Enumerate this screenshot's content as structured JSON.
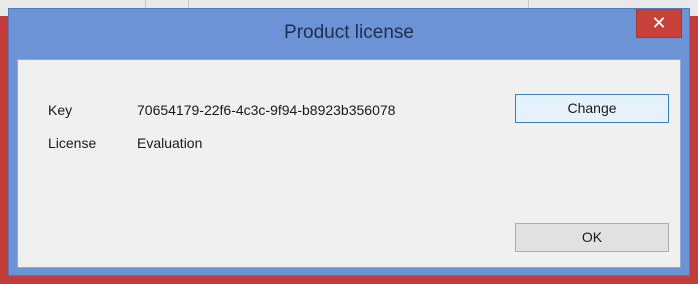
{
  "window": {
    "title": "Product license",
    "close_glyph": "✕"
  },
  "license": {
    "key_label": "Key",
    "key_value": "70654179-22f6-4c3c-9f94-b8923b356078",
    "license_label": "License",
    "license_value": "Evaluation"
  },
  "buttons": {
    "change_label": "Change",
    "ok_label": "OK"
  },
  "colors": {
    "titlebar": "#6b93d6",
    "close_button": "#c7403a",
    "client_bg": "#f0f0f0",
    "outer_border": "#c33b3b"
  }
}
